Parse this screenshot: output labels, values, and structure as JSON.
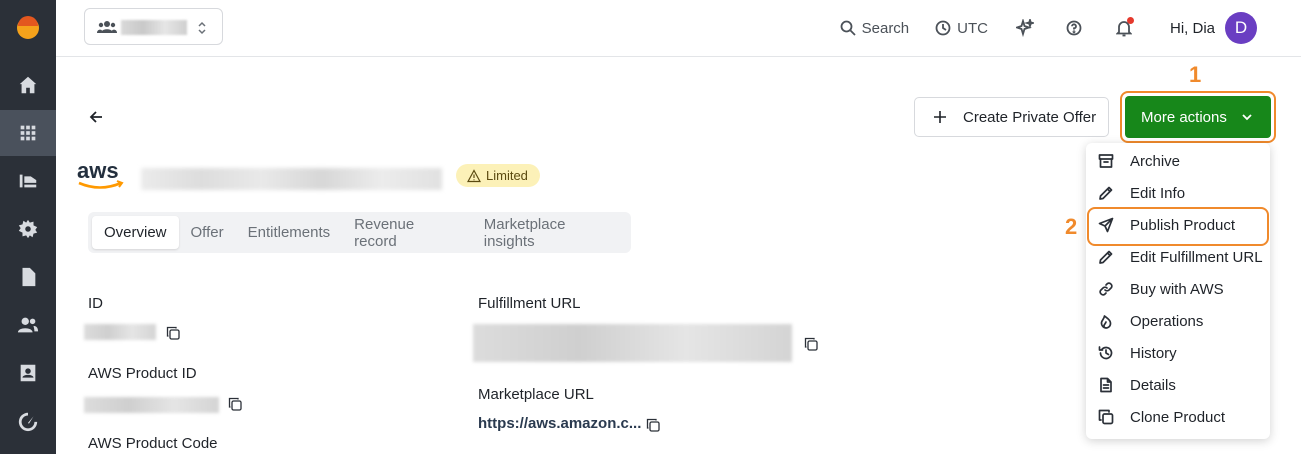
{
  "topbar": {
    "search_label": "Search",
    "timezone_label": "UTC",
    "greeting": "Hi, Dia",
    "avatar_initial": "D"
  },
  "sidebar": {
    "items": [
      {
        "icon": "home-icon"
      },
      {
        "icon": "apps-grid-icon",
        "active": true
      },
      {
        "icon": "products-icon"
      },
      {
        "icon": "settings-icon"
      },
      {
        "icon": "document-icon"
      },
      {
        "icon": "users-icon"
      },
      {
        "icon": "contacts-icon"
      },
      {
        "icon": "speedometer-icon"
      }
    ]
  },
  "actions": {
    "create_private_offer": "Create Private Offer",
    "more_actions": "More actions"
  },
  "annotations": {
    "step1": "1",
    "step2": "2"
  },
  "product": {
    "brand": "aws",
    "status_badge": "Limited"
  },
  "tabs": [
    {
      "label": "Overview",
      "active": true
    },
    {
      "label": "Offer"
    },
    {
      "label": "Entitlements"
    },
    {
      "label": "Revenue record"
    },
    {
      "label": "Marketplace insights"
    }
  ],
  "fields": {
    "id_label": "ID",
    "aws_product_id_label": "AWS Product ID",
    "aws_product_code_label": "AWS Product Code",
    "fulfillment_url_label": "Fulfillment URL",
    "marketplace_url_label": "Marketplace URL",
    "marketplace_url_value": "https://aws.amazon.c..."
  },
  "dropdown": {
    "items": [
      {
        "label": "Archive",
        "icon": "archive-icon"
      },
      {
        "label": "Edit Info",
        "icon": "pencil-icon"
      },
      {
        "label": "Publish Product",
        "icon": "send-icon",
        "highlighted": true
      },
      {
        "label": "Edit Fulfillment URL",
        "icon": "pencil-icon"
      },
      {
        "label": "Buy with AWS",
        "icon": "link-icon"
      },
      {
        "label": "Operations",
        "icon": "flame-icon"
      },
      {
        "label": "History",
        "icon": "history-icon"
      },
      {
        "label": "Details",
        "icon": "document-icon"
      },
      {
        "label": "Clone Product",
        "icon": "clone-icon"
      }
    ]
  },
  "colors": {
    "primary_button": "#17871a",
    "annotation": "#f08a2c",
    "sidebar": "#2b3038",
    "avatar": "#6a3ec2",
    "badge": "#fcf1b8"
  }
}
